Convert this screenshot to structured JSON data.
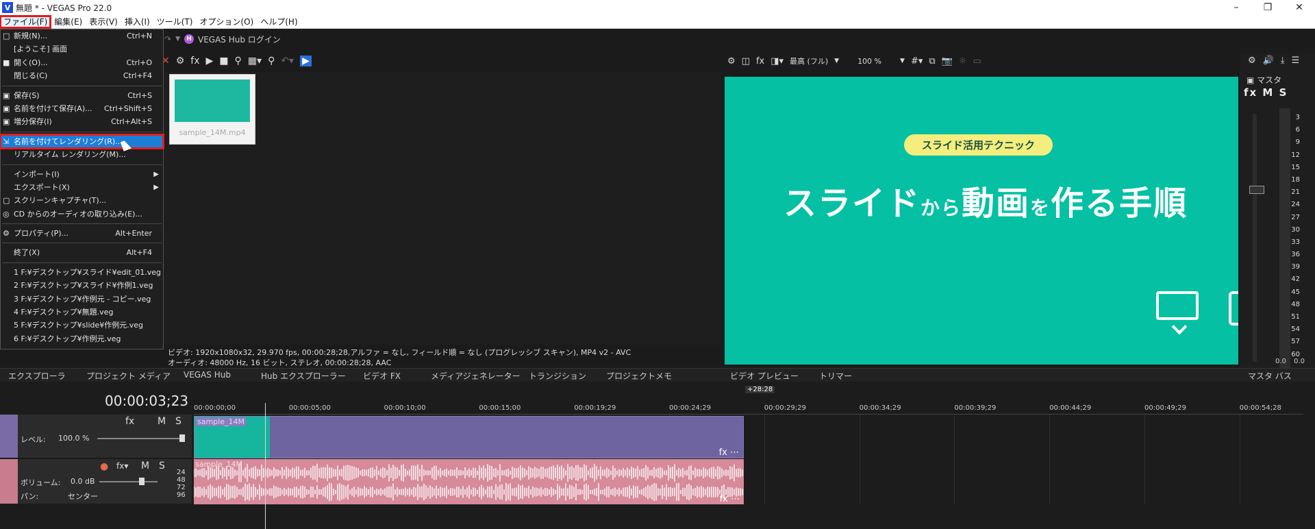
{
  "window": {
    "title": "無題 * - VEGAS Pro 22.0",
    "app_icon": "V"
  },
  "menubar": [
    "ファイル(F)",
    "編集(E)",
    "表示(V)",
    "挿入(I)",
    "ツール(T)",
    "オプション(O)",
    "ヘルプ(H)"
  ],
  "hub": {
    "label": "VEGAS Hub ログイン"
  },
  "file_menu": [
    {
      "label": "新規(N)...",
      "sc": "Ctrl+N",
      "icon": "new-file-icon"
    },
    {
      "label": "[ようこそ] 画面",
      "sc": ""
    },
    {
      "label": "開く(O)...",
      "sc": "Ctrl+O",
      "icon": "open-folder-icon"
    },
    {
      "label": "閉じる(C)",
      "sc": "Ctrl+F4"
    },
    {
      "sep": true
    },
    {
      "label": "保存(S)",
      "sc": "Ctrl+S",
      "icon": "save-icon"
    },
    {
      "label": "名前を付けて保存(A)...",
      "sc": "Ctrl+Shift+S",
      "icon": "save-as-icon"
    },
    {
      "label": "増分保存(I)",
      "sc": "Ctrl+Alt+S",
      "icon": "incremental-save-icon"
    },
    {
      "sep": true
    },
    {
      "label": "名前を付けてレンダリング(R)...",
      "sc": "",
      "icon": "render-icon",
      "highlight": true
    },
    {
      "label": "リアルタイム レンダリング(M)...",
      "sc": ""
    },
    {
      "sep": true
    },
    {
      "label": "インポート(I)",
      "sc": "",
      "submenu": true
    },
    {
      "label": "エクスポート(X)",
      "sc": "",
      "submenu": true
    },
    {
      "label": "スクリーンキャプチャ(T)...",
      "sc": "",
      "icon": "screen-capture-icon"
    },
    {
      "label": "CD からのオーディオの取り込み(E)...",
      "sc": "",
      "icon": "cd-icon"
    },
    {
      "sep": true
    },
    {
      "label": "プロパティ(P)...",
      "sc": "Alt+Enter",
      "icon": "properties-gear-icon"
    },
    {
      "sep": true
    },
    {
      "label": "終了(X)",
      "sc": "Alt+F4"
    },
    {
      "sep": true
    },
    {
      "label": "1 F:¥デスクトップ¥スライド¥edit_01.veg",
      "sc": ""
    },
    {
      "label": "2 F:¥デスクトップ¥スライド¥作例1.veg",
      "sc": ""
    },
    {
      "label": "3 F:¥デスクトップ¥作例元 - コピー.veg",
      "sc": ""
    },
    {
      "label": "4 F:¥デスクトップ¥無題.veg",
      "sc": ""
    },
    {
      "label": "5 F:¥デスクトップ¥slide¥作例元.veg",
      "sc": ""
    },
    {
      "label": "6 F:¥デスクトップ¥作例元.veg",
      "sc": ""
    }
  ],
  "media": {
    "file": "sample_14M.mp4",
    "info1": "ビデオ: 1920x1080x32, 29.970 fps, 00:00:28;28,アルファ = なし, フィールド順 = なし (プログレッシブ スキャン), MP4 v2 - AVC",
    "info2": "オーディオ: 48000 Hz, 16 ビット, ステレオ, 00:00:28;28, AAC"
  },
  "preview": {
    "quality": "最高 (フル)",
    "zoom": "100 %",
    "badge": "スライド活用テクニック",
    "headline_a": "スライド",
    "headline_b": "から",
    "headline_c": "動画",
    "headline_d": "を",
    "headline_e": "作る手順"
  },
  "master": {
    "label": "マスタ",
    "fx_row": "fx M S",
    "scale": [
      "3",
      "6",
      "9",
      "12",
      "15",
      "18",
      "21",
      "24",
      "27",
      "30",
      "33",
      "36",
      "39",
      "42",
      "45",
      "48",
      "51",
      "54",
      "57",
      "60"
    ],
    "zero": "0.0 0.0"
  },
  "tabs": [
    "エクスプローラ",
    "プロジェクト メディア",
    "VEGAS Hub",
    "Hub エクスプローラー",
    "ビデオ FX",
    "メディアジェネレーター",
    "トランジション",
    "プロジェクトメモ",
    "ビデオ プレビュー",
    "トリマー",
    "マスタ バス"
  ],
  "timeline": {
    "timecode": "00:00:03;23",
    "end_marker": "+28:28",
    "ruler": [
      "00:00:00;00",
      "00:00:05;00",
      "00:00:10;00",
      "00:00:15;00",
      "00:00:19;29",
      "00:00:24;29",
      "00:00:29;29",
      "00:00:34;29",
      "00:00:39;29",
      "00:00:44;29",
      "00:00:49;29",
      "00:00:54;28"
    ],
    "video_track": {
      "level_label": "レベル:",
      "level_value": "100.0 %",
      "clip": "sample_14M"
    },
    "audio_track": {
      "volume_label": "ボリューム:",
      "volume_value": "0.0 dB",
      "pan_label": "パン:",
      "pan_value": "センター",
      "clip": "sample_14M",
      "meter": [
        "24",
        "48",
        "72",
        "96"
      ]
    }
  }
}
